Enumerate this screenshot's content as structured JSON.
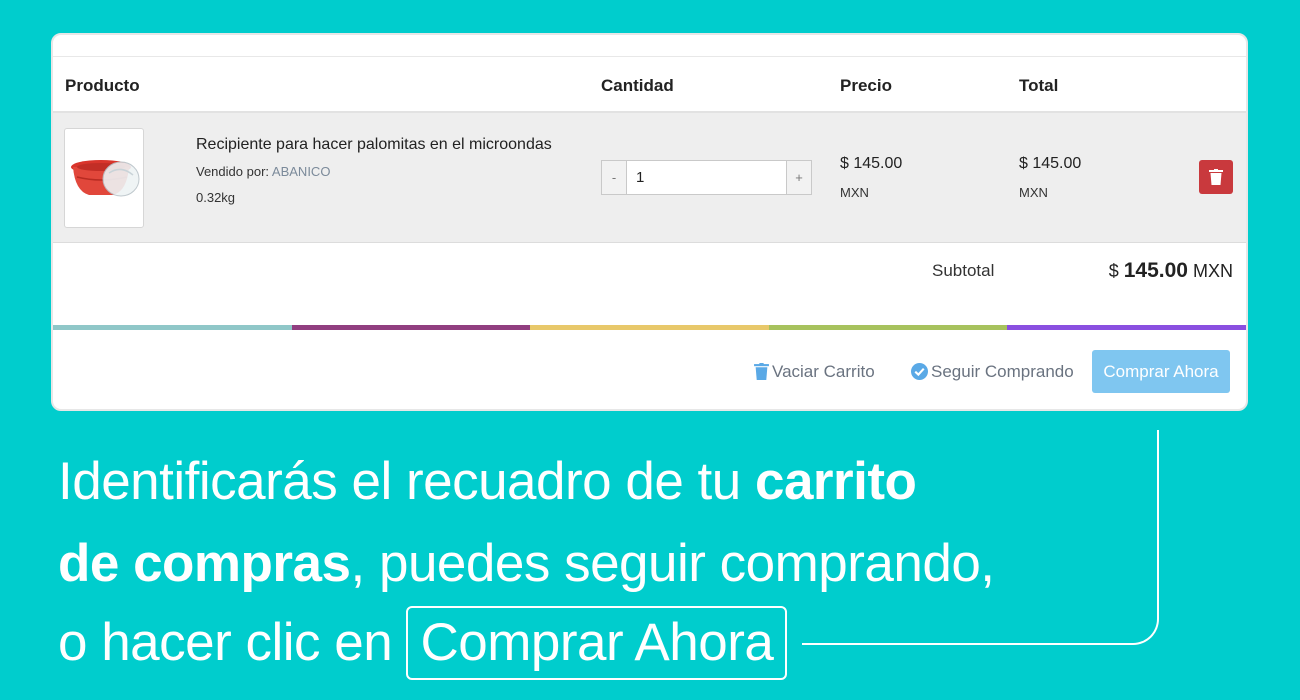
{
  "table": {
    "headers": {
      "product": "Producto",
      "quantity": "Cantidad",
      "price": "Precio",
      "total": "Total"
    }
  },
  "item": {
    "name": "Recipiente para hacer palomitas en el microondas",
    "sold_by_label": "Vendido por:",
    "store": "ABANICO",
    "weight": "0.32kg",
    "quantity": "1",
    "qty_minus": "-",
    "qty_plus": "+",
    "price": "$ 145.00",
    "price_currency": "MXN",
    "total": "$ 145.00",
    "total_currency": "MXN",
    "image_icon": "red-popcorn-bowl"
  },
  "summary": {
    "subtotal_label": "Subtotal",
    "subtotal_symbol": "$",
    "subtotal_amount": "145.00",
    "subtotal_currency": "MXN"
  },
  "actions": {
    "empty_cart": "Vaciar Carrito",
    "continue_shopping": "Seguir Comprando",
    "buy_now": "Comprar Ahora"
  },
  "stripe_colors": [
    "#8fc7c8",
    "#913e80",
    "#e8c86a",
    "#a7c25d",
    "#8a4fe0"
  ],
  "colors": {
    "background": "#00cdcd",
    "delete": "#c9393d",
    "buy_button": "#7fc6f0"
  },
  "caption": {
    "line1_text": "Identificarás el recuadro de tu ",
    "line1_bold": "carrito",
    "line2_bold": "de compras",
    "line2_text": ", puedes seguir comprando,",
    "line3_text": "o hacer clic en",
    "line3_boxed": "Comprar Ahora"
  }
}
